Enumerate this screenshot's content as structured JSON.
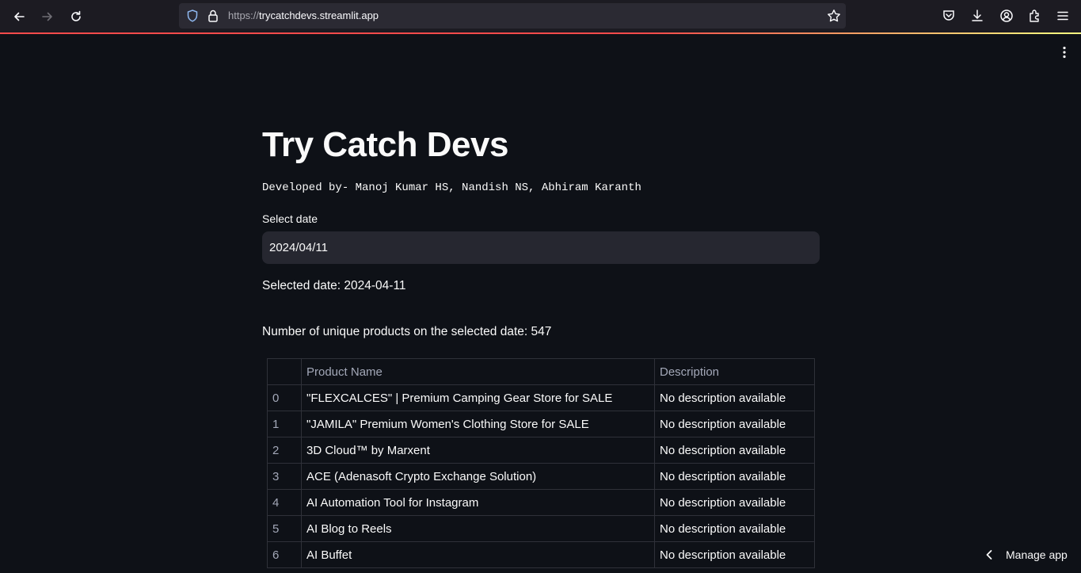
{
  "browser": {
    "url_protocol": "https://",
    "url_host": "trycatchdevs.streamlit.app"
  },
  "icons": {
    "back": "back-arrow-icon",
    "forward": "forward-arrow-icon",
    "reload": "reload-icon",
    "shield": "shield-icon",
    "lock": "lock-icon",
    "bookmark": "star-icon",
    "pocket": "pocket-icon",
    "downloads": "download-icon",
    "account": "account-icon",
    "extensions": "puzzle-icon",
    "menu": "hamburger-menu-icon",
    "app_menu": "kebab-menu-icon",
    "manage_chevron": "chevron-left-icon"
  },
  "colors": {
    "background": "#0e1117",
    "input_bg": "#262730",
    "accent": "#ff4b4b"
  },
  "app": {
    "title": "Try Catch Devs",
    "developed_by": "Developed by- Manoj Kumar HS, Nandish NS, Abhiram Karanth",
    "date_label": "Select date",
    "date_value": "2024/04/11",
    "selected_date_text": "Selected date: 2024-04-11",
    "count_text": "Number of unique products on the selected date: 547",
    "manage_app": "Manage app"
  },
  "table": {
    "columns": [
      "",
      "Product Name",
      "Description"
    ],
    "rows": [
      {
        "index": "0",
        "name": "\"FLEXCALCES\" | Premium Camping Gear Store for SALE",
        "description": "No description available"
      },
      {
        "index": "1",
        "name": "\"JAMILA\" Premium Women's Clothing Store for SALE",
        "description": "No description available"
      },
      {
        "index": "2",
        "name": "3D Cloud™ by Marxent",
        "description": "No description available"
      },
      {
        "index": "3",
        "name": "ACE (Adenasoft Crypto Exchange Solution)",
        "description": "No description available"
      },
      {
        "index": "4",
        "name": "AI Automation Tool for Instagram",
        "description": "No description available"
      },
      {
        "index": "5",
        "name": "AI Blog to Reels",
        "description": "No description available"
      },
      {
        "index": "6",
        "name": "AI Buffet",
        "description": "No description available"
      }
    ]
  }
}
